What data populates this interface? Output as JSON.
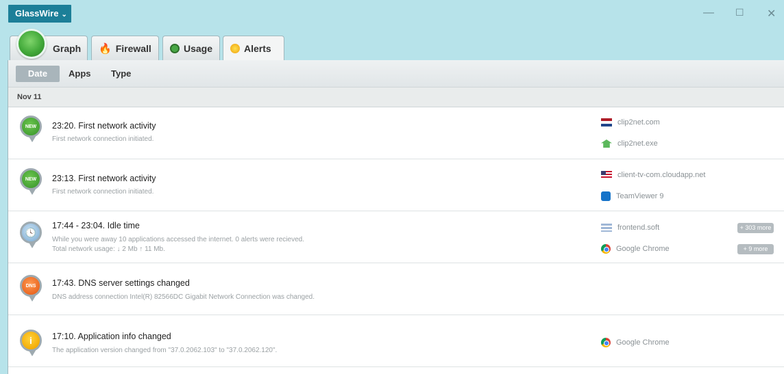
{
  "titlebar": {
    "app_menu": "GlassWire",
    "chevron": "⌄",
    "minimize": "—",
    "maximize": "☐",
    "close": "✕"
  },
  "tabs": [
    {
      "label": "Graph",
      "icon": "graph-logo-icon"
    },
    {
      "label": "Firewall",
      "icon": "flame-icon"
    },
    {
      "label": "Usage",
      "icon": "usage-icon"
    },
    {
      "label": "Alerts",
      "icon": "alert-bulb-icon",
      "active": true
    }
  ],
  "filters": {
    "date": "Date",
    "apps": "Apps",
    "type": "Type",
    "selected": "Date"
  },
  "date_header": "Nov 11",
  "alerts": [
    {
      "pin": "NEW",
      "title": "23:20. First network activity",
      "desc": "First network connection initiated.",
      "apps": [
        {
          "name": "clip2net.com",
          "icon": "netherlands-flag-icon"
        },
        {
          "name": "clip2net.exe",
          "icon": "app-icon"
        }
      ]
    },
    {
      "pin": "NEW",
      "title": "23:13. First network activity",
      "desc": "First network connection initiated.",
      "apps": [
        {
          "name": "client-tv-com.cloudapp.net",
          "icon": "us-flag-icon"
        },
        {
          "name": "TeamViewer 9",
          "icon": "teamviewer-icon"
        }
      ]
    },
    {
      "pin": "🕓",
      "title": "17:44  - 23:04. Idle time",
      "desc": "While you were away 10 applications accessed the internet. 0 alerts were recieved.",
      "desc2": "Total network usage:  ↓ 2 Mb   ↑ 11 Mb.",
      "apps": [
        {
          "name": "frontend.soft",
          "icon": "flag-icon",
          "more": "+ 303 more"
        },
        {
          "name": "Google Chrome",
          "icon": "chrome-icon",
          "more": "+ 9 more"
        }
      ]
    },
    {
      "pin": "DNS",
      "title": "17:43. DNS server settings changed",
      "desc": "DNS address connection Intel(R) 82566DC Gigabit Network Connection was changed.",
      "apps": []
    },
    {
      "pin": "i",
      "title": "17:10. Application info changed",
      "desc": "The application version changed from \"37.0.2062.103\" to \"37.0.2062.120\".",
      "apps": [
        {
          "name": "Google Chrome",
          "icon": "chrome-icon"
        }
      ]
    }
  ],
  "colors": {
    "titlebar_bg": "#b7e3ea",
    "app_menu_bg": "#1c7f98",
    "new_pin": "#3f9c2f",
    "dns_pin": "#e8611c",
    "info_pin": "#f2a800"
  }
}
